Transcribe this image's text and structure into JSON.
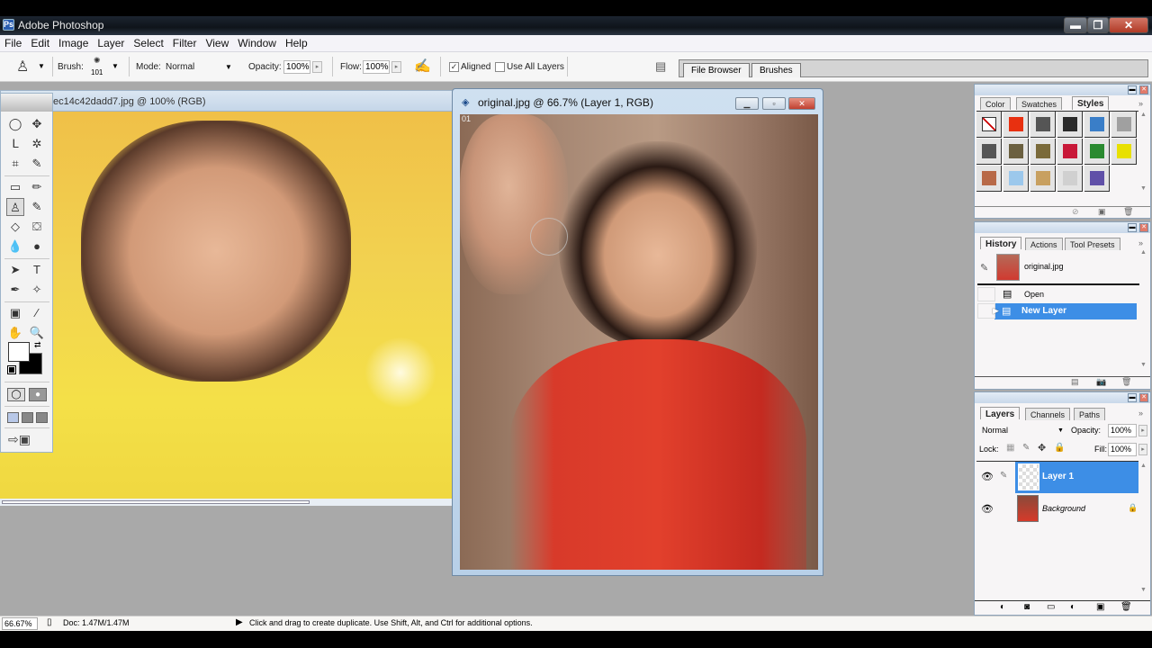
{
  "window": {
    "title": "Adobe Photoshop",
    "app_icon": "photoshop-icon",
    "minimize": "▬",
    "maximize": "❐",
    "close": "✕"
  },
  "menu": [
    "File",
    "Edit",
    "Image",
    "Layer",
    "Select",
    "Filter",
    "View",
    "Window",
    "Help"
  ],
  "options": {
    "tool_icon": "clone-stamp-icon",
    "brush_label": "Brush:",
    "brush_size": "101",
    "mode_label": "Mode:",
    "mode_value": "Normal",
    "opacity_label": "Opacity:",
    "opacity_value": "100%",
    "flow_label": "Flow:",
    "flow_value": "100%",
    "aligned_label": "Aligned",
    "aligned_checked": true,
    "use_all_layers_label": "Use All Layers",
    "use_all_layers_checked": false,
    "well_tabs": [
      "File Browser",
      "Brushes"
    ]
  },
  "documents": [
    {
      "title": "ec14c42dadd7.jpg @ 100% (RGB)"
    },
    {
      "title": "original.jpg @ 66.7% (Layer 1, RGB)",
      "badge": "01"
    }
  ],
  "toolbox": {
    "tools": [
      [
        "marquee-icon",
        "move-icon"
      ],
      [
        "lasso-icon",
        "magic-wand-icon"
      ],
      [
        "crop-icon",
        "slice-icon"
      ],
      [
        "healing-brush-icon",
        "pencil-icon"
      ],
      [
        "clone-stamp-icon",
        "history-brush-icon"
      ],
      [
        "eraser-icon",
        "paint-bucket-icon"
      ],
      [
        "blur-icon",
        "dodge-icon"
      ],
      [
        "path-selection-icon",
        "type-icon"
      ],
      [
        "pen-icon",
        "custom-shape-icon"
      ],
      [
        "notes-icon",
        "eyedropper-icon"
      ],
      [
        "hand-icon",
        "zoom-icon"
      ]
    ],
    "glyphs": [
      [
        "◯",
        "✥"
      ],
      [
        "ᒪ",
        "✲"
      ],
      [
        "⌗",
        "✎"
      ],
      [
        "▭",
        "✏"
      ],
      [
        "♙",
        "✎"
      ],
      [
        "◇",
        "⛋"
      ],
      [
        "💧",
        "●"
      ],
      [
        "➤",
        "T"
      ],
      [
        "✒",
        "✧"
      ],
      [
        "▣",
        "⁄"
      ],
      [
        "✋",
        "🔍"
      ]
    ],
    "foreground_color": "#ffffff",
    "background_color": "#000000"
  },
  "styles_palette": {
    "tabs": [
      "Color",
      "Swatches",
      "Styles"
    ],
    "active_tab": "Styles",
    "swatches": [
      "#ffffff",
      "#e83010",
      "#555555",
      "#2a2a2a",
      "#3a7ec8",
      "#a0a0a0",
      "#555",
      "#6b6040",
      "#7a6a3a",
      "#c81838",
      "#2a8a30",
      "#e8e000",
      "#b86a48",
      "#9cc8ec",
      "#c8a060",
      "#d0d0d0",
      "#6050a8"
    ]
  },
  "history_palette": {
    "tabs": [
      "History",
      "Actions",
      "Tool Presets"
    ],
    "active_tab": "History",
    "snapshot": "original.jpg",
    "items": [
      {
        "label": "Open",
        "selected": false
      },
      {
        "label": "New Layer",
        "selected": true
      }
    ]
  },
  "layers_palette": {
    "tabs": [
      "Layers",
      "Channels",
      "Paths"
    ],
    "active_tab": "Layers",
    "blend_mode": "Normal",
    "opacity_label": "Opacity:",
    "opacity_value": "100%",
    "lock_label": "Lock:",
    "fill_label": "Fill:",
    "fill_value": "100%",
    "layers": [
      {
        "name": "Layer 1",
        "selected": true,
        "visible": true
      },
      {
        "name": "Background",
        "selected": false,
        "visible": true,
        "locked": true
      }
    ]
  },
  "status": {
    "zoom": "66.67%",
    "doc": "Doc: 1.47M/1.47M",
    "hint": "Click and drag to create duplicate.  Use Shift, Alt, and Ctrl for additional options."
  }
}
